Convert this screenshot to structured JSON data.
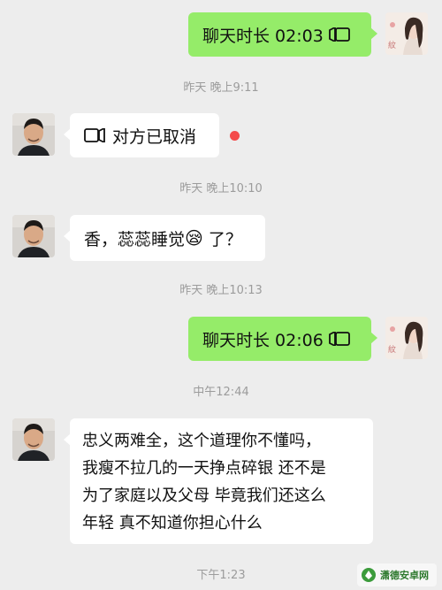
{
  "messages": {
    "m1": {
      "text": "聊天时长 02:03"
    },
    "t1": {
      "text": "昨天 晚上9:11"
    },
    "m2": {
      "text": "对方已取消"
    },
    "t2": {
      "text": "昨天 晚上10:10"
    },
    "m3": {
      "text_before": "香，蕊蕊睡觉",
      "emoji": "😪",
      "text_after": " 了？"
    },
    "t3": {
      "text": "昨天 晚上10:13"
    },
    "m4": {
      "text": "聊天时长 02:06"
    },
    "t4": {
      "text": "中午12:44"
    },
    "m5": {
      "lines": [
        "忠义两难全，这个道理你不懂吗，",
        "我瘦不拉几的一天挣点碎银 还不是",
        "为了家庭以及父母 毕竟我们还这么",
        "年轻 真不知道你担心什么"
      ]
    },
    "t5": {
      "text": "下午1:23"
    }
  },
  "avatar_right_caption": "紋",
  "watermark": {
    "text": "潇德安卓网"
  },
  "colors": {
    "background": "#ededed",
    "sent_bubble": "#95ec69",
    "received_bubble": "#ffffff",
    "timestamp": "#9c9c9c",
    "unread_dot": "#f44b4b"
  },
  "icons": [
    "video-call-icon",
    "video-call-icon-flipped"
  ]
}
